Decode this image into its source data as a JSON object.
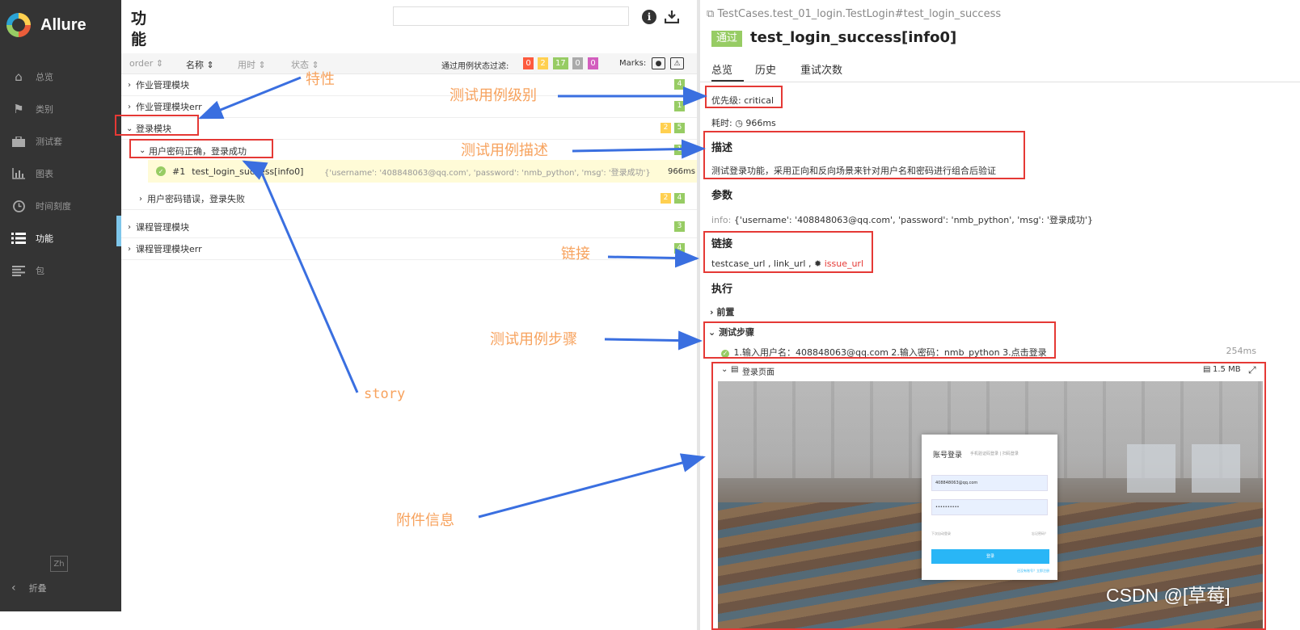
{
  "sidebar": {
    "brand": "Allure",
    "items": [
      {
        "label": "总览",
        "icon": "home-icon"
      },
      {
        "label": "类别",
        "icon": "flag-icon"
      },
      {
        "label": "测试套",
        "icon": "briefcase-icon"
      },
      {
        "label": "图表",
        "icon": "bar-chart-icon"
      },
      {
        "label": "时间刻度",
        "icon": "clock-icon"
      },
      {
        "label": "功能",
        "icon": "list-icon",
        "active": true
      },
      {
        "label": "包",
        "icon": "align-left-icon"
      }
    ],
    "language": "Zh",
    "collapse_label": "折叠"
  },
  "tree": {
    "title": "功能",
    "sort": {
      "order": "order",
      "name": "名称",
      "duration": "用时",
      "status": "状态"
    },
    "filter_label": "通过用例状态过滤:",
    "filter_badges": [
      {
        "value": "0",
        "color": "#fd5a3e"
      },
      {
        "value": "2",
        "color": "#ffd050"
      },
      {
        "value": "17",
        "color": "#97cc64"
      },
      {
        "value": "0",
        "color": "#aaaaaa"
      },
      {
        "value": "0",
        "color": "#d35ebe"
      }
    ],
    "marks_label": "Marks:",
    "rows": [
      {
        "label": "作业管理模块",
        "counts": [
          "4"
        ]
      },
      {
        "label": "作业管理模块err",
        "counts": [
          "1"
        ]
      },
      {
        "label": "登录模块",
        "counts": [
          "2",
          "5"
        ]
      },
      {
        "label": "用户密码正确，登录成功",
        "counts": [
          "1"
        ]
      },
      {
        "label": "用户密码错误，登录失败",
        "counts": [
          "2",
          "4"
        ]
      },
      {
        "label": "课程管理模块",
        "counts": [
          "3"
        ]
      },
      {
        "label": "课程管理模块err",
        "counts": [
          "4"
        ]
      }
    ],
    "test": {
      "number": "#1",
      "name": "test_login_success[info0]",
      "params": "{'username': '408848063@qq.com', 'password': 'nmb_python', 'msg': '登录成功'}",
      "duration": "966ms"
    }
  },
  "detail": {
    "breadcrumb": "TestCases.test_01_login.TestLogin#test_login_success",
    "status": "通过",
    "title": "test_login_success[info0]",
    "tabs": [
      "总览",
      "历史",
      "重试次数"
    ],
    "severity": "优先级: critical",
    "duration_label": "耗时:",
    "duration": "966ms",
    "description_heading": "描述",
    "description": "测试登录功能，采用正向和反向场景来针对用户名和密码进行组合后验证",
    "params_heading": "参数",
    "param_key": "info:",
    "param_value": "{'username': '408848063@qq.com', 'password': 'nmb_python', 'msg': '登录成功'}",
    "links_heading": "链接",
    "links": {
      "testcase": "testcase_url",
      "link": "link_url",
      "issue": "issue_url"
    },
    "execution_heading": "执行",
    "setup_label": "前置",
    "steps_label": "测试步骤",
    "step_text": "1.输入用户名：408848063@qq.com 2.输入密码：nmb_python 3.点击登录",
    "step_duration": "254ms",
    "attachment_name": "登录页面",
    "attachment_size": "1.5 MB",
    "login_card": {
      "title": "账号登录",
      "tabs": "手机验证码登录   |   扫码登录",
      "username": "408848063@qq.com",
      "password": "••••••••••",
      "remember": "下次自动登录",
      "forgot": "忘记密码？",
      "button": "登录",
      "footer": "还没有账号？立即注册"
    }
  },
  "annotations": {
    "feature": "特性",
    "story": "story",
    "severity": "测试用例级别",
    "description": "测试用例描述",
    "link": "链接",
    "steps": "测试用例步骤",
    "attachment": "附件信息"
  },
  "watermark": "CSDN @[草莓]",
  "colors": {
    "passed": "#97cc64",
    "broken": "#ffd050",
    "failed": "#fd5a3e",
    "annotation": "#f7a25d",
    "highlight_box": "#e53935",
    "arrow": "#3a6fe0"
  }
}
